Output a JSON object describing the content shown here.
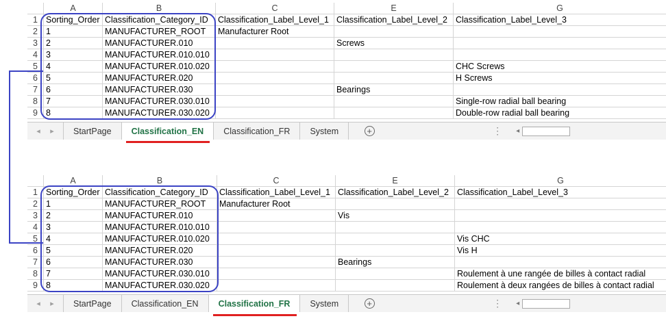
{
  "columns": [
    "A",
    "B",
    "C",
    "E",
    "G"
  ],
  "header_row": {
    "row_num": "1",
    "cells": [
      "Sorting_Order",
      "Classification_Category_ID",
      "Classification_Label_Level_1",
      "Classification_Label_Level_2",
      "Classification_Label_Level_3"
    ]
  },
  "sheets": [
    {
      "name": "Classification_EN",
      "rows": [
        {
          "n": "2",
          "a": "1",
          "b": "MANUFACTURER_ROOT",
          "c": "Manufacturer Root",
          "e": "",
          "g": ""
        },
        {
          "n": "3",
          "a": "2",
          "b": "MANUFACTURER.010",
          "c": "",
          "e": "Screws",
          "g": ""
        },
        {
          "n": "4",
          "a": "3",
          "b": "MANUFACTURER.010.010",
          "c": "",
          "e": "",
          "g": ""
        },
        {
          "n": "5",
          "a": "4",
          "b": "MANUFACTURER.010.020",
          "c": "",
          "e": "",
          "g": "CHC Screws"
        },
        {
          "n": "6",
          "a": "5",
          "b": "MANUFACTURER.020",
          "c": "",
          "e": "",
          "g": "H Screws"
        },
        {
          "n": "7",
          "a": "6",
          "b": "MANUFACTURER.030",
          "c": "",
          "e": "Bearings",
          "g": ""
        },
        {
          "n": "8",
          "a": "7",
          "b": "MANUFACTURER.030.010",
          "c": "",
          "e": "",
          "g": "Single-row radial ball bearing"
        },
        {
          "n": "9",
          "a": "8",
          "b": "MANUFACTURER.030.020",
          "c": "",
          "e": "",
          "g": "Double-row radial ball bearing"
        }
      ]
    },
    {
      "name": "Classification_FR",
      "rows": [
        {
          "n": "2",
          "a": "1",
          "b": "MANUFACTURER_ROOT",
          "c": "Manufacturer Root",
          "e": "",
          "g": ""
        },
        {
          "n": "3",
          "a": "2",
          "b": "MANUFACTURER.010",
          "c": "",
          "e": "Vis",
          "g": ""
        },
        {
          "n": "4",
          "a": "3",
          "b": "MANUFACTURER.010.010",
          "c": "",
          "e": "",
          "g": ""
        },
        {
          "n": "5",
          "a": "4",
          "b": "MANUFACTURER.010.020",
          "c": "",
          "e": "",
          "g": "Vis CHC"
        },
        {
          "n": "6",
          "a": "5",
          "b": "MANUFACTURER.020",
          "c": "",
          "e": "",
          "g": "Vis H"
        },
        {
          "n": "7",
          "a": "6",
          "b": "MANUFACTURER.030",
          "c": "",
          "e": "Bearings",
          "g": ""
        },
        {
          "n": "8",
          "a": "7",
          "b": "MANUFACTURER.030.010",
          "c": "",
          "e": "",
          "g": "Roulement à une rangée de billes à contact radial"
        },
        {
          "n": "9",
          "a": "8",
          "b": "MANUFACTURER.030.020",
          "c": "",
          "e": "",
          "g": "Roulement à deux rangées de billes à contact radial"
        }
      ]
    }
  ],
  "tabs": [
    "StartPage",
    "Classification_EN",
    "Classification_FR",
    "System"
  ],
  "active_tab_en": "Classification_EN",
  "active_tab_fr": "Classification_FR",
  "icons": {
    "nav_prev": "◂",
    "nav_next": "▸",
    "add_sheet": "+",
    "more": "⋮",
    "scroll_left": "◂"
  },
  "colors": {
    "annotation": "#3b43c4",
    "underline": "#e02020",
    "active_tab_text": "#217346"
  }
}
